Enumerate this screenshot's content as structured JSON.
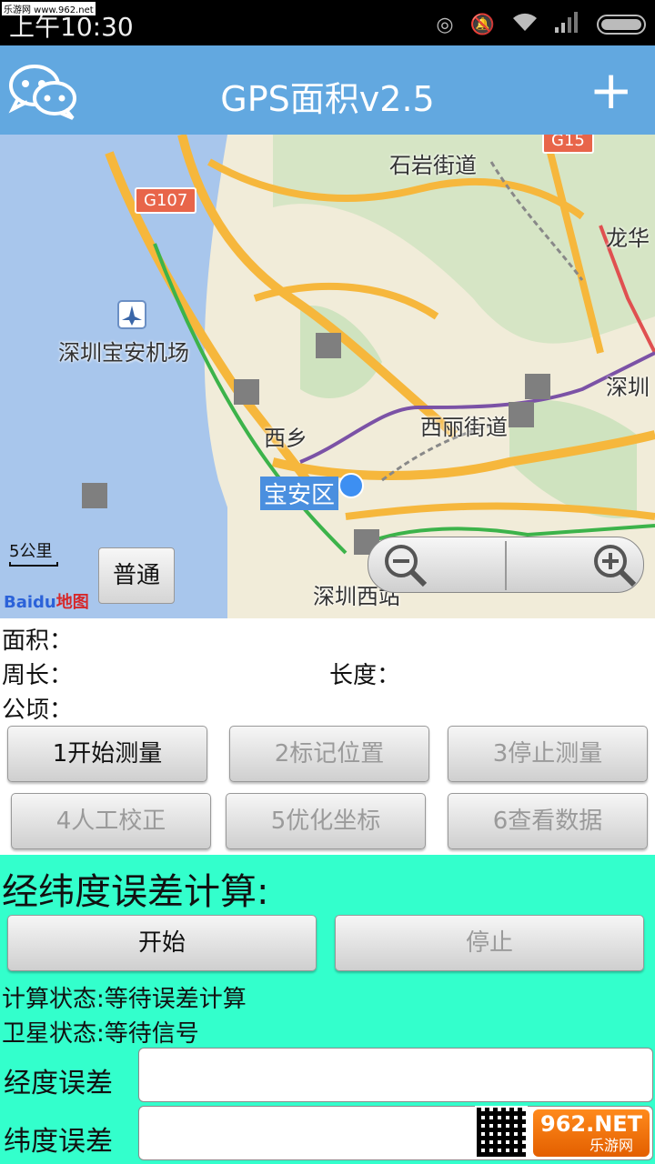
{
  "status_bar": {
    "time": "上午10:30",
    "watermark": "乐游网 www.962.net"
  },
  "app_bar": {
    "title": "GPS面积v2.5",
    "add_label": "+"
  },
  "map": {
    "labels": {
      "shiyan": "石岩街道",
      "airport": "深圳宝安机场",
      "xixiang": "西乡",
      "xili": "西丽街道",
      "baoan": "宝安区",
      "longhua": "龙华",
      "shenzhen": "深圳",
      "shenzhen_west": "深圳西站"
    },
    "road_badges": {
      "g107": "G107",
      "g15": "G15"
    },
    "scale": "5公里",
    "mode_button": "普通",
    "baidu_logo": "Bai",
    "baidu_logo_du": "du",
    "baidu_logo_map": "地图"
  },
  "measure": {
    "area_label": "面积：",
    "perimeter_label": "周长：",
    "length_label": "长度：",
    "hectare_label": "公顷：",
    "buttons": [
      {
        "label": "1开始测量",
        "enabled": true
      },
      {
        "label": "2标记位置",
        "enabled": false
      },
      {
        "label": "3停止测量",
        "enabled": false
      },
      {
        "label": "4人工校正",
        "enabled": false
      },
      {
        "label": "5优化坐标",
        "enabled": false
      },
      {
        "label": "6查看数据",
        "enabled": false
      }
    ]
  },
  "error_calc": {
    "heading": "经纬度误差计算:",
    "start_label": "开始",
    "stop_label": "停止",
    "calc_status": "计算状态:等待误差计算",
    "satellite_status": "卫星状态:等待信号",
    "lon_error_label": "经度误差",
    "lon_error_value": "",
    "lat_error_label": "纬度误差",
    "lat_error_value": ""
  },
  "watermark": {
    "brand": "962.NET",
    "sub": "乐游网"
  },
  "colors": {
    "app_bar": "#62a8e0",
    "panel": "#33ffcc"
  }
}
